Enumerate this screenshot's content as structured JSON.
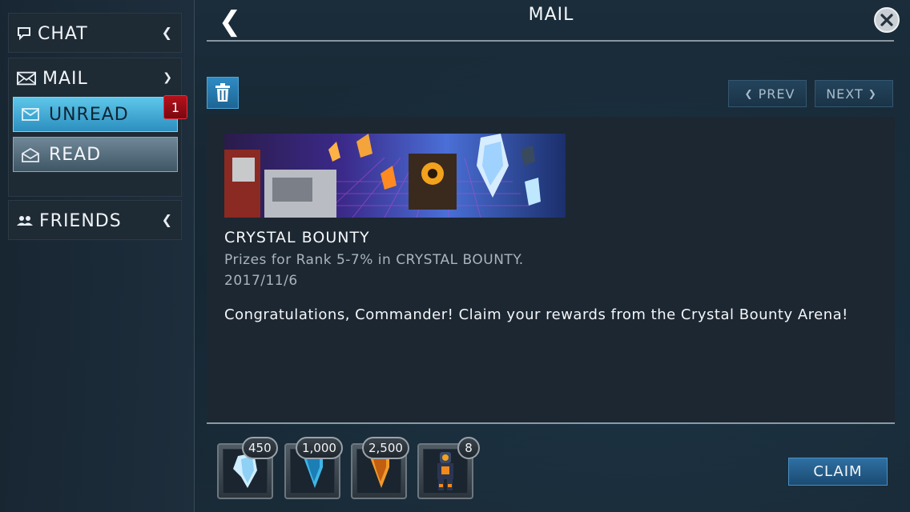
{
  "header": {
    "title": "MAIL"
  },
  "sidebar": {
    "chat_label": "CHAT",
    "mail_label": "MAIL",
    "mail_items": [
      {
        "label": "UNREAD",
        "badge": "1"
      },
      {
        "label": "READ"
      }
    ],
    "friends_label": "FRIENDS"
  },
  "toolbar": {
    "prev_label": "PREV",
    "next_label": "NEXT"
  },
  "message": {
    "title": "CRYSTAL BOUNTY",
    "subtitle": "Prizes for Rank 5-7% in CRYSTAL BOUNTY.",
    "date": "2017/11/6",
    "body": "Congratulations, Commander! Claim your rewards from the Crystal Bounty Arena!"
  },
  "rewards": [
    {
      "icon": "crystal-white-icon",
      "qty": "450"
    },
    {
      "icon": "crystal-blue-icon",
      "qty": "1,000"
    },
    {
      "icon": "crystal-orange-icon",
      "qty": "2,500"
    },
    {
      "icon": "character-figure-icon",
      "qty": "8"
    }
  ],
  "claim_label": "CLAIM",
  "colors": {
    "accent": "#2c8fbf",
    "badge": "#b4111b",
    "panel": "#1c2732"
  }
}
